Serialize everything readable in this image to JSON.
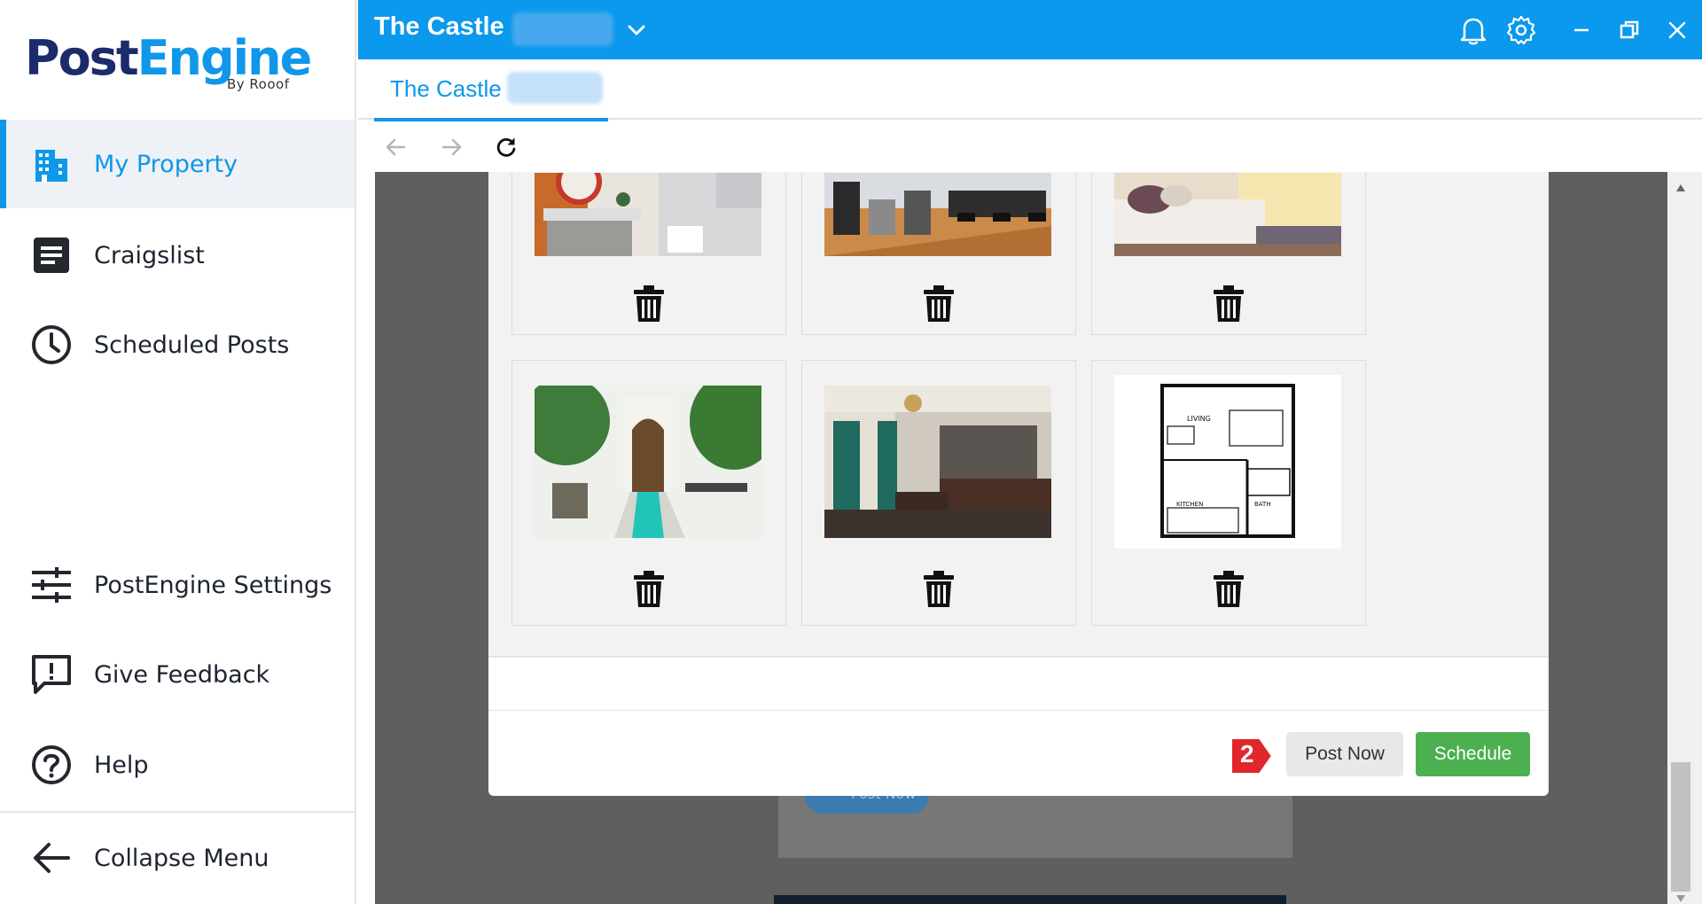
{
  "sidebar": {
    "logo_main_part1": "Post",
    "logo_main_part2": "Engine",
    "logo_sub": "By Rooof",
    "items": [
      {
        "label": "My Property",
        "icon": "building-icon"
      },
      {
        "label": "Craigslist",
        "icon": "document-icon"
      },
      {
        "label": "Scheduled Posts",
        "icon": "clock-icon"
      },
      {
        "label": "PostEngine Settings",
        "icon": "sliders-icon"
      },
      {
        "label": "Give Feedback",
        "icon": "feedback-icon"
      },
      {
        "label": "Help",
        "icon": "help-icon"
      },
      {
        "label": "Collapse Menu",
        "icon": "arrow-left-icon"
      }
    ]
  },
  "titlebar": {
    "title": "The Castle",
    "icons": [
      "chevron-down-icon",
      "bell-icon",
      "gear-icon",
      "minimize-icon",
      "restore-icon",
      "close-icon"
    ]
  },
  "tab": {
    "label": "The Castle"
  },
  "toolbar": {
    "icons": [
      "back-arrow-icon",
      "forward-arrow-icon",
      "refresh-icon"
    ]
  },
  "gallery": {
    "photos": [
      {
        "name": "bathroom-photo"
      },
      {
        "name": "gym-photo"
      },
      {
        "name": "bedroom-photo"
      },
      {
        "name": "pool-courtyard-photo"
      },
      {
        "name": "living-room-photo"
      },
      {
        "name": "floor-plan-photo",
        "labels": [
          "LIVING",
          "KITCHEN",
          "BATH"
        ]
      }
    ]
  },
  "behind": {
    "post_now_label": "Post Now"
  },
  "modal": {
    "post_now_label": "Post Now",
    "schedule_label": "Schedule",
    "marker_number": "2"
  },
  "colors": {
    "accent": "#0a99ec",
    "logo_dark": "#1b2b6b",
    "schedule_green": "#4cb050",
    "marker_red": "#e0262a"
  }
}
